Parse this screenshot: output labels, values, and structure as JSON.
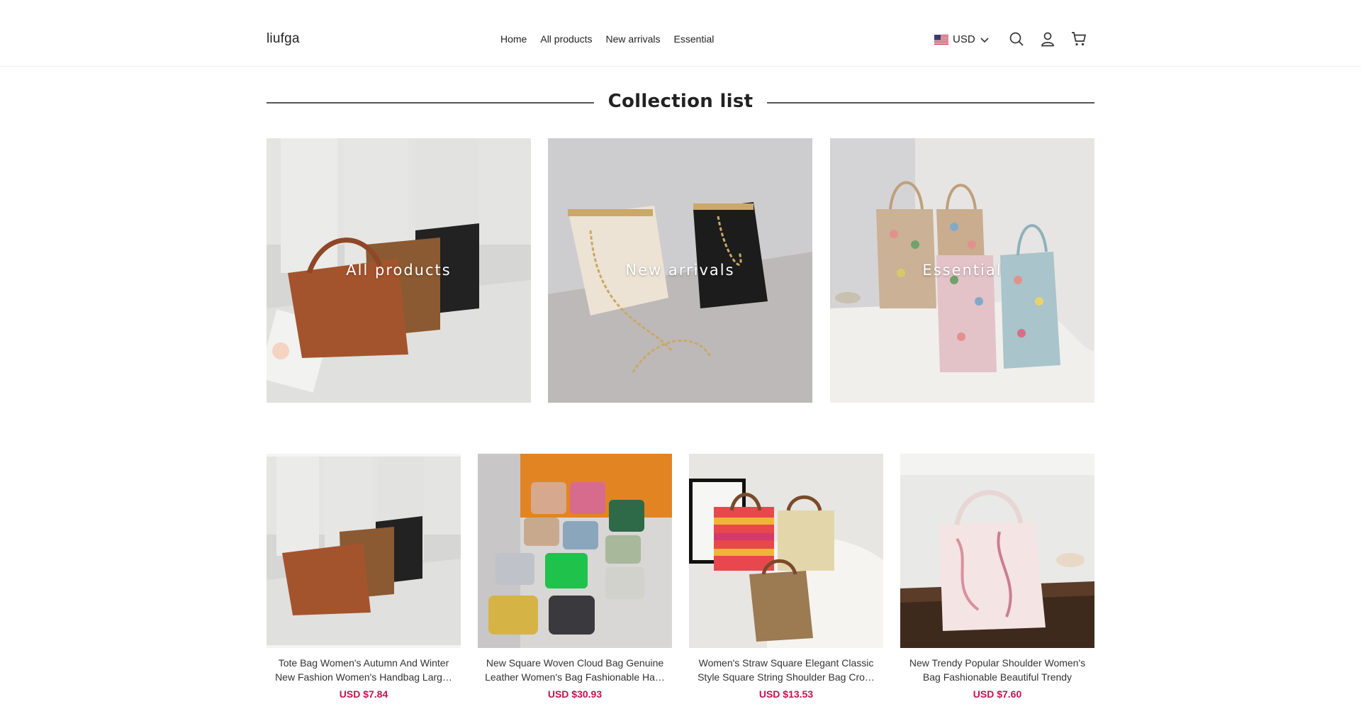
{
  "header": {
    "logo": "liufga",
    "nav": [
      "Home",
      "All products",
      "New arrivals",
      "Essential"
    ],
    "currency": "USD",
    "icons": [
      "us-flag-icon",
      "chevron-down-icon",
      "search-icon",
      "user-icon",
      "cart-icon"
    ]
  },
  "section": {
    "title": "Collection list"
  },
  "collections": [
    {
      "label": "All products"
    },
    {
      "label": "New arrivals"
    },
    {
      "label": "Essential"
    }
  ],
  "products": [
    {
      "name": "Tote Bag Women's Autumn And Winter New Fashion Women's Handbag Larg…",
      "price": "USD $7.84"
    },
    {
      "name": "New Square Woven Cloud Bag Genuine Leather Women's Bag Fashionable Ha…",
      "price": "USD $30.93"
    },
    {
      "name": "Women's Straw Square Elegant Classic Style Square String Shoulder Bag Cro…",
      "price": "USD $13.53"
    },
    {
      "name": "New Trendy Popular Shoulder Women's Bag Fashionable Beautiful Trendy Pers…",
      "price": "USD $7.60"
    }
  ],
  "colors": {
    "price": "#c4124b",
    "text": "#222222",
    "divider": "#555555"
  }
}
